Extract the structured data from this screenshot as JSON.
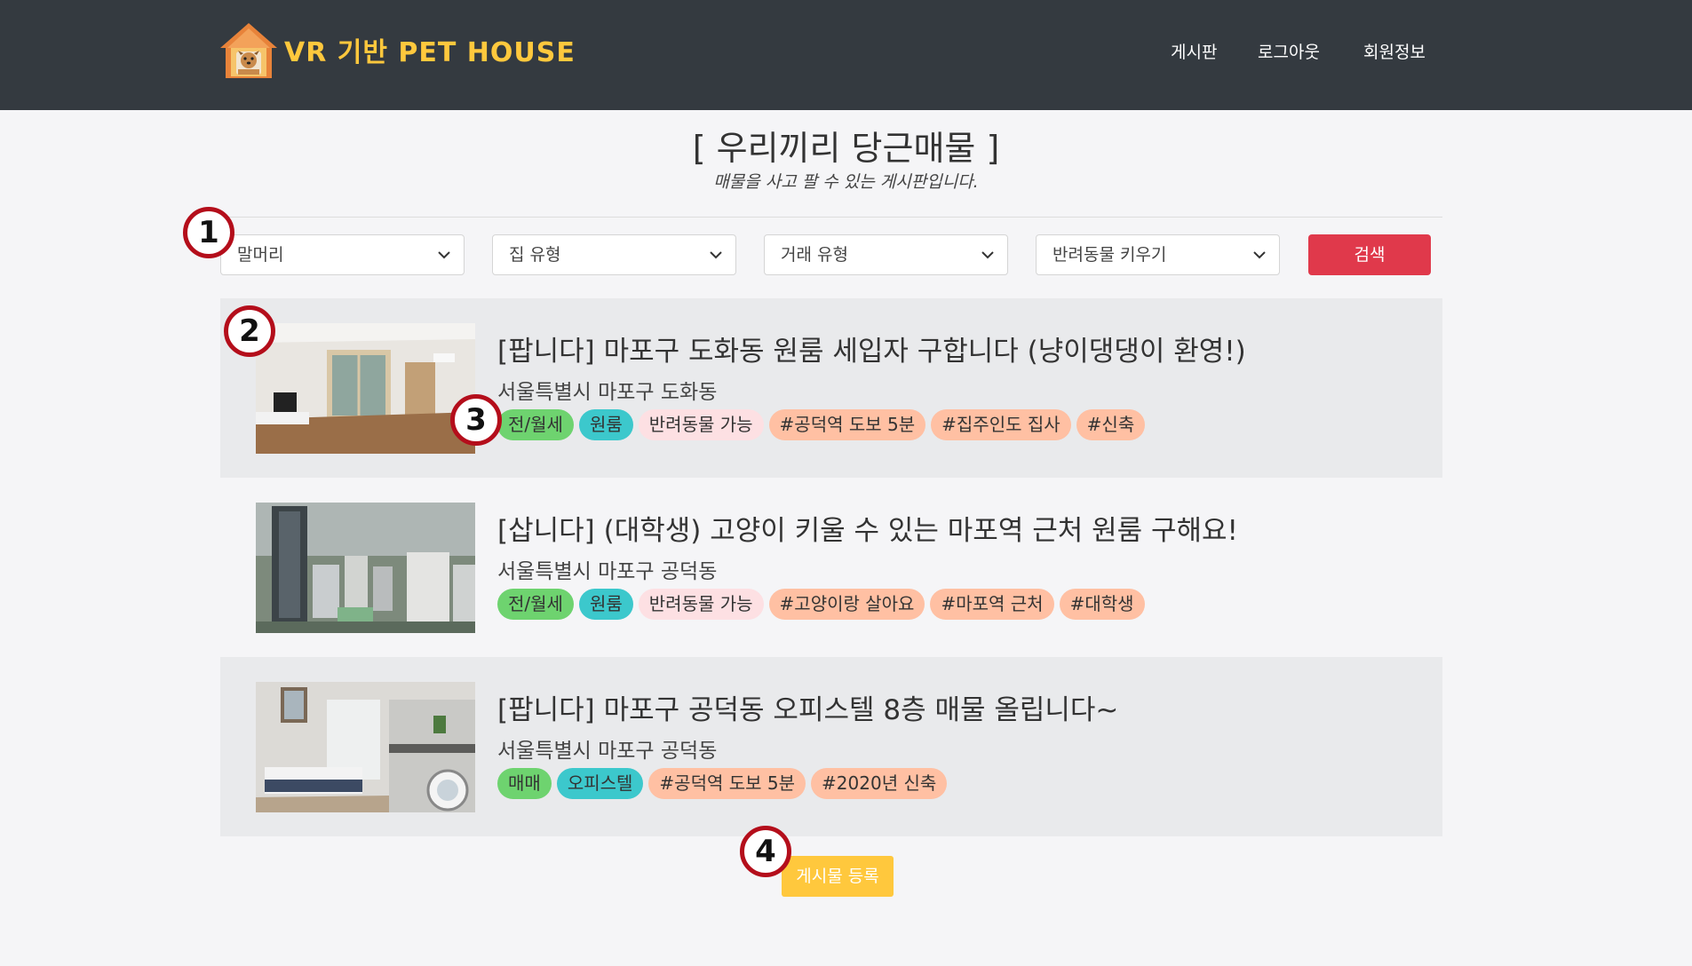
{
  "header": {
    "brand": "VR 기반 PET HOUSE",
    "nav": [
      "게시판",
      "로그아웃",
      "회원정보"
    ]
  },
  "page": {
    "title": "[ 우리끼리 당근매물 ]",
    "subtitle": "매물을 사고 팔 수 있는 게시판입니다."
  },
  "filters": {
    "selects": [
      "말머리",
      "집 유형",
      "거래 유형",
      "반려동물 키우기"
    ],
    "search_label": "검색"
  },
  "listings": [
    {
      "title": "[팝니다] 마포구 도화동 원룸 세입자 구합니다 (냥이댕댕이 환영!)",
      "location": "서울특별시 마포구 도화동",
      "tags": [
        {
          "text": "전/월세",
          "kind": "deal"
        },
        {
          "text": "원룸",
          "kind": "type"
        },
        {
          "text": "반려동물 가능",
          "kind": "pet"
        },
        {
          "text": "#공덕역 도보 5분",
          "kind": "hashtag"
        },
        {
          "text": "#집주인도 집사",
          "kind": "hashtag"
        },
        {
          "text": "#신축",
          "kind": "hashtag"
        }
      ]
    },
    {
      "title": "[삽니다] (대학생) 고양이 키울 수 있는 마포역 근처 원룸 구해요!",
      "location": "서울특별시 마포구 공덕동",
      "tags": [
        {
          "text": "전/월세",
          "kind": "deal"
        },
        {
          "text": "원룸",
          "kind": "type"
        },
        {
          "text": "반려동물 가능",
          "kind": "pet"
        },
        {
          "text": "#고양이랑 살아요",
          "kind": "hashtag"
        },
        {
          "text": "#마포역 근처",
          "kind": "hashtag"
        },
        {
          "text": "#대학생",
          "kind": "hashtag"
        }
      ]
    },
    {
      "title": "[팝니다] 마포구 공덕동 오피스텔 8층 매물 올립니다~",
      "location": "서울특별시 마포구 공덕동",
      "tags": [
        {
          "text": "매매",
          "kind": "deal"
        },
        {
          "text": "오피스텔",
          "kind": "type"
        },
        {
          "text": "#공덕역 도보 5분",
          "kind": "hashtag"
        },
        {
          "text": "#2020년 신축",
          "kind": "hashtag"
        }
      ]
    }
  ],
  "register_label": "게시물 등록",
  "markers": [
    "1",
    "2",
    "3",
    "4"
  ],
  "colors": {
    "header_bg": "#343a40",
    "brand": "#ffc83d",
    "search": "#e0394b",
    "register": "#ffc83d",
    "tag_deal": "#6ed36f",
    "tag_type": "#3cc8cc",
    "tag_pet": "#fde0e3",
    "tag_hashtag": "#ffc0a3",
    "marker_ring": "#b40e1b"
  }
}
